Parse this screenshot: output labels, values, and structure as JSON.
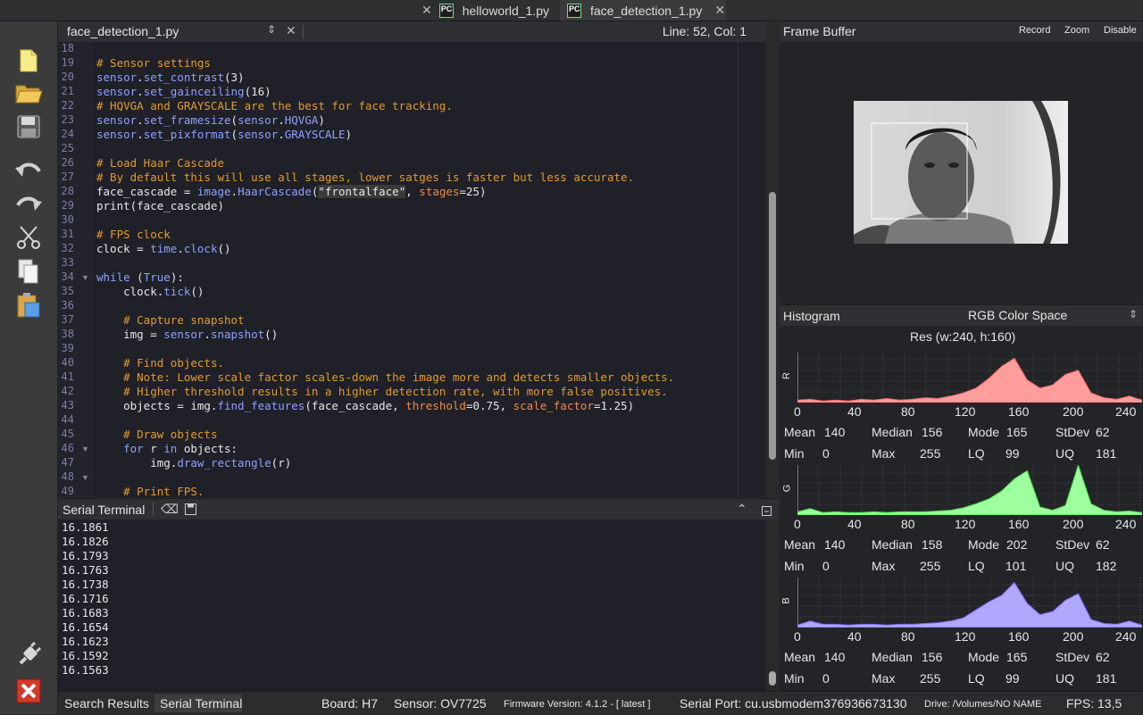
{
  "tabs": [
    {
      "label": "helloworld_1.py",
      "active": false
    },
    {
      "label": "face_detection_1.py",
      "active": true
    }
  ],
  "toolbar": {
    "icons": [
      "new-file-icon",
      "open-folder-icon",
      "save-icon",
      "undo-icon",
      "redo-icon",
      "cut-icon",
      "copy-icon",
      "paste-icon",
      "connect-icon",
      "disconnect-icon"
    ]
  },
  "editor": {
    "filename": "face_detection_1.py",
    "cursor": "Line: 52, Col: 1",
    "line_numbers": [
      "18",
      "19",
      "20",
      "21",
      "22",
      "23",
      "24",
      "25",
      "26",
      "27",
      "28",
      "29",
      "30",
      "31",
      "32",
      "33",
      "34",
      "35",
      "36",
      "37",
      "38",
      "39",
      "40",
      "41",
      "42",
      "43",
      "44",
      "45",
      "46",
      "47",
      "48",
      "49"
    ],
    "lines": [
      "",
      "# Sensor settings",
      "sensor.set_contrast(3)",
      "sensor.set_gainceiling(16)",
      "# HQVGA and GRAYSCALE are the best for face tracking.",
      "sensor.set_framesize(sensor.HQVGA)",
      "sensor.set_pixformat(sensor.GRAYSCALE)",
      "",
      "# Load Haar Cascade",
      "# By default this will use all stages, lower satges is faster but less accurate.",
      "face_cascade = image.HaarCascade(\"frontalface\", stages=25)",
      "print(face_cascade)",
      "",
      "# FPS clock",
      "clock = time.clock()",
      "",
      "while (True):",
      "    clock.tick()",
      "",
      "    # Capture snapshot",
      "    img = sensor.snapshot()",
      "",
      "    # Find objects.",
      "    # Note: Lower scale factor scales-down the image more and detects smaller objects.",
      "    # Higher threshold results in a higher detection rate, with more false positives.",
      "    objects = img.find_features(face_cascade, threshold=0.75, scale_factor=1.25)",
      "",
      "    # Draw objects",
      "    for r in objects:",
      "        img.draw_rectangle(r)",
      "",
      "    # Print FPS."
    ]
  },
  "terminal": {
    "title": "Serial Terminal",
    "lines": [
      "16.1861",
      "16.1826",
      "16.1793",
      "16.1763",
      "16.1738",
      "16.1716",
      "16.1683",
      "16.1654",
      "16.1623",
      "16.1592",
      "16.1563"
    ]
  },
  "framebuffer": {
    "title": "Frame Buffer",
    "record": "Record",
    "zoom": "Zoom",
    "disable": "Disable"
  },
  "histogram": {
    "title": "Histogram",
    "colorspace": "RGB Color Space",
    "res": "Res (w:240, h:160)",
    "x_ticks": [
      "0",
      "40",
      "80",
      "120",
      "160",
      "200",
      "240"
    ],
    "channels": [
      {
        "label": "R",
        "color": "#ff9d9d",
        "line": "#ff6a6a",
        "mean": "140",
        "median": "156",
        "mode": "165",
        "stdev": "62",
        "min": "0",
        "max": "255",
        "lq": "99",
        "uq": "181"
      },
      {
        "label": "G",
        "color": "#9dff9d",
        "line": "#4be04b",
        "mean": "140",
        "median": "158",
        "mode": "202",
        "stdev": "62",
        "min": "0",
        "max": "255",
        "lq": "101",
        "uq": "182"
      },
      {
        "label": "B",
        "color": "#b0a8ff",
        "line": "#7a6cff",
        "mean": "140",
        "median": "156",
        "mode": "165",
        "stdev": "62",
        "min": "0",
        "max": "255",
        "lq": "99",
        "uq": "181"
      }
    ],
    "stat_labels": {
      "mean": "Mean",
      "median": "Median",
      "mode": "Mode",
      "stdev": "StDev",
      "min": "Min",
      "max": "Max",
      "lq": "LQ",
      "uq": "UQ"
    }
  },
  "status": {
    "search_results": "Search Results",
    "serial_terminal": "Serial Terminal",
    "board": "Board: H7",
    "sensor": "Sensor: OV7725",
    "firmware": "Firmware Version: 4.1.2 - [ latest ]",
    "serial_port": "Serial Port: cu.usbmodem376936673130",
    "drive": "Drive: /Volumes/NO NAME",
    "fps": "FPS: 13,5"
  }
}
